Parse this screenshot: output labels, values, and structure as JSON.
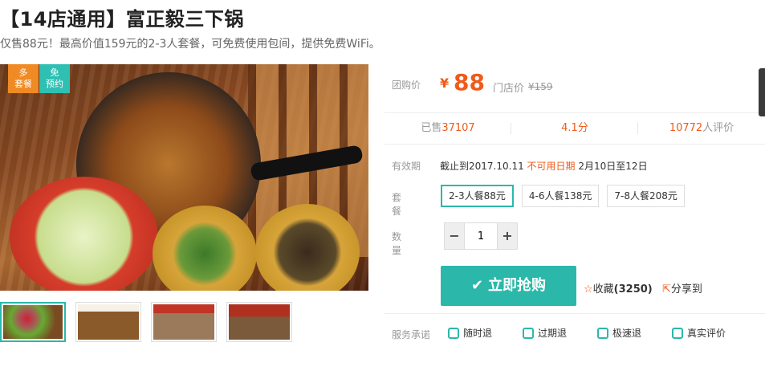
{
  "title": "【14店通用】富正毅三下锅",
  "subtitle": "仅售88元！最高价值159元的2-3人套餐，可免费使用包间，提供免费WiFi。",
  "tags": {
    "multi_store": "多\n套餐",
    "no_reservation": "免\n预约"
  },
  "price": {
    "label": "团购价",
    "currency": "¥",
    "value": "88",
    "store_price_label": "门店价",
    "store_price": "¥159"
  },
  "stats": {
    "sold_label": "已售",
    "sold": "37107",
    "rating": "4.1",
    "rating_unit": "分",
    "reviews": "10772",
    "reviews_label": "人评价"
  },
  "validity": {
    "label": "有效期",
    "until": "截止到2017.10.11",
    "unavailable_label": "不可用日期",
    "unavailable": "2月10日至12日"
  },
  "combo": {
    "label": "套餐",
    "options": [
      "2-3人餐88元",
      "4-6人餐138元",
      "7-8人餐208元"
    ],
    "selected": "2-3人餐88元"
  },
  "quantity": {
    "label": "数量",
    "value": "1",
    "minus": "−",
    "plus": "+"
  },
  "buy_button": "立即抢购",
  "favorite": {
    "label": "收藏",
    "count": "(3250)"
  },
  "share": "分享到",
  "promise": {
    "label": "服务承诺",
    "items": [
      "随时退",
      "过期退",
      "极速退",
      "真实评价"
    ]
  }
}
